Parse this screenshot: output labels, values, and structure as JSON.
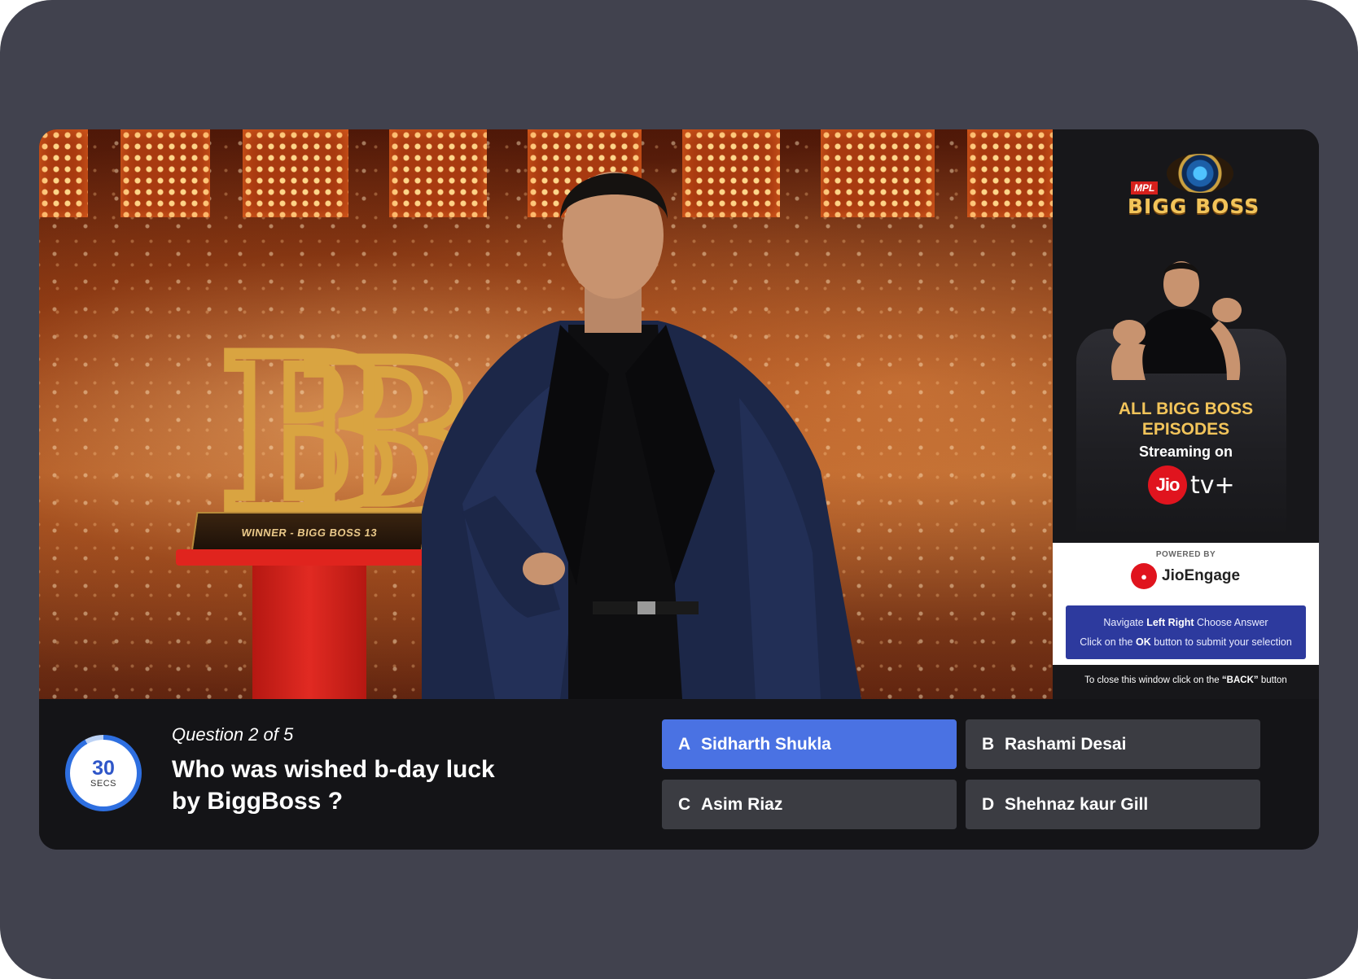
{
  "stage": {
    "plaque_text": "WINNER - BIGG BOSS 13"
  },
  "promo": {
    "logo_brand": "MPL",
    "logo_text": "BIGG BOSS",
    "headline_line1": "ALL BIGG BOSS",
    "headline_line2": "EPISODES",
    "subline": "Streaming on",
    "jio_label": "Jio",
    "tv_label": "tv+",
    "powered_by": "POWERED BY",
    "engage_name": "JioEngage",
    "help_line1_prefix": "Navigate",
    "help_line1_keys": "Left Right",
    "help_line1_suffix": "Choose Answer",
    "help_line2_prefix": "Click on the",
    "help_line2_key": "OK",
    "help_line2_suffix": "button to submit your selection",
    "close_prefix": "To close this window click on the",
    "close_key": "“BACK”",
    "close_suffix": "button"
  },
  "quiz": {
    "timer_value": "30",
    "timer_unit": "SECS",
    "question_index": "Question 2 of 5",
    "question_line1": "Who was wished b-day luck",
    "question_line2": "by BiggBoss ?",
    "options": [
      {
        "letter": "A",
        "label": "Sidharth Shukla",
        "selected": true
      },
      {
        "letter": "B",
        "label": "Rashami Desai",
        "selected": false
      },
      {
        "letter": "C",
        "label": "Asim Riaz",
        "selected": false
      },
      {
        "letter": "D",
        "label": "Shehnaz kaur Gill",
        "selected": false
      }
    ]
  },
  "colors": {
    "device_bezel": "#41424e",
    "screen_bg": "#141417",
    "selected_option": "#4a72e3",
    "option_bg": "#3b3c42",
    "promo_gold": "#f2c45a",
    "help_box": "#2d3a9e",
    "jio_red": "#e0141e"
  }
}
